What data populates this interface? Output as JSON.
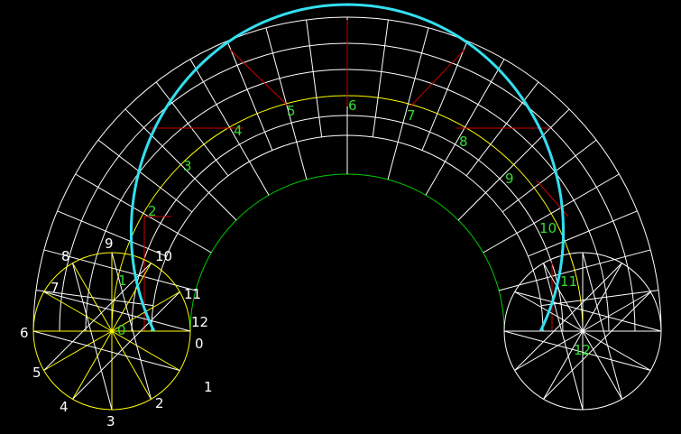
{
  "colors": {
    "background": "#000000",
    "grid": "#ffffff",
    "construction_circle": "#ffff00",
    "inner_circle": "#00cc00",
    "construction_lines": "#cc0000",
    "curve": "#33e0f0",
    "label_green": "#33dd33",
    "label_white": "#ffffff"
  },
  "left_circle_labels": [
    "0",
    "1",
    "2",
    "3",
    "4",
    "5",
    "6",
    "7",
    "8",
    "9",
    "10",
    "11",
    "12"
  ],
  "left_center_label": "0",
  "arc_labels": [
    "1",
    "2",
    "3",
    "4",
    "5",
    "6",
    "7",
    "8",
    "9",
    "10",
    "11"
  ],
  "right_center_label": "12"
}
